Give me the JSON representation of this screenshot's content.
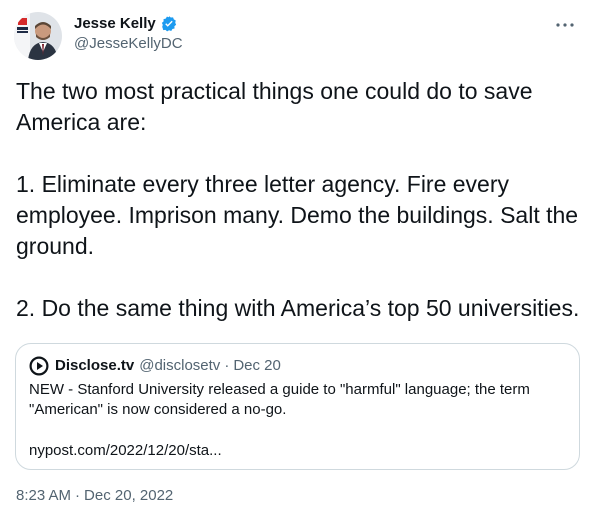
{
  "author": {
    "display_name": "Jesse Kelly",
    "handle": "@JesseKellyDC",
    "verified": true,
    "verified_color": "#1d9bf0"
  },
  "tweet": {
    "paragraphs": [
      "The two most practical things one could do to save America are:",
      "1. Eliminate every three letter agency. Fire every employee. Imprison many. Demo the buildings. Salt the ground.",
      "2. Do the same thing with America’s top 50 universities."
    ],
    "time": "8:23 AM",
    "separator": "·",
    "date": "Dec 20, 2022"
  },
  "quoted_tweet": {
    "display_name": "Disclose.tv",
    "handle": "@disclosetv",
    "separator": "·",
    "date": "Dec 20",
    "text": "NEW - Stanford University released a guide to \"harmful\" language; the term \"American\" is now considered a no-go.",
    "link": "nypost.com/2022/12/20/sta..."
  },
  "icons": {
    "more": "more-options-icon",
    "verified": "verified-badge-icon",
    "quote_avatar": "play-circle-icon"
  },
  "colors": {
    "text": "#0f1419",
    "secondary": "#536471",
    "border": "#cfd9de"
  }
}
